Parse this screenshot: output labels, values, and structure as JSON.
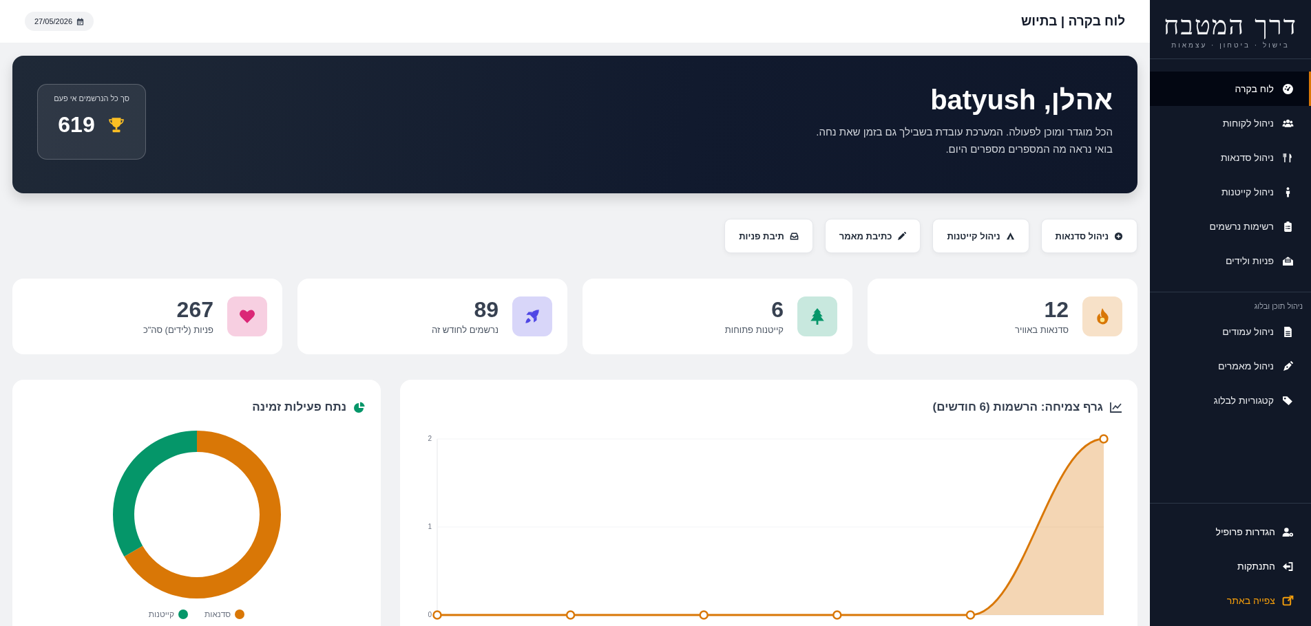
{
  "sidebar": {
    "logo": {
      "title": "דרך המטבח",
      "tagline": "בישול · ביטחון · עצמאות"
    },
    "items": [
      {
        "label": "לוח בקרה",
        "selected": true
      },
      {
        "label": "ניהול לקוחות",
        "selected": false
      },
      {
        "label": "ניהול סדנאות",
        "selected": false
      },
      {
        "label": "ניהול קייטנות",
        "selected": false
      },
      {
        "label": "רשימות נרשמים",
        "selected": false
      },
      {
        "label": "פניות ולידים",
        "selected": false
      }
    ],
    "section_title": "ניהול תוכן ובלוג",
    "blog_items": [
      {
        "label": "ניהול עמודים",
        "selected": false
      },
      {
        "label": "ניהול מאמרים",
        "selected": false
      },
      {
        "label": "קטגוריות לבלוג",
        "selected": false
      }
    ],
    "footer_items": [
      {
        "label": "הגדרות פרופיל",
        "kind": "normal"
      },
      {
        "label": "התנתקות",
        "kind": "normal"
      },
      {
        "label": "צפייה באתר",
        "kind": "external"
      }
    ]
  },
  "header": {
    "title": "לוח בקרה | בתיוש",
    "date": "27/05/2026"
  },
  "banner": {
    "greeting": "אהלן, batyush",
    "lines": [
      "הכל מוגדר ומוכן לפעולה. המערכת עובדת בשבילך גם בזמן שאת נחה.",
      "בואי נראה מה המספרים מספרים היום."
    ],
    "total_label": "סך כל הנרשמים אי פעם",
    "total_value": "619"
  },
  "quick_actions": [
    "ניהול סדנאות",
    "ניהול קייטנות",
    "כתיבת מאמר",
    "תיבת פניות"
  ],
  "stats": [
    {
      "value": "12",
      "label": "סדנאות באוויר",
      "color": "#d97706"
    },
    {
      "value": "6",
      "label": "קייטנות פתוחות",
      "color": "#059669"
    },
    {
      "value": "89",
      "label": "נרשמים לחודש זה",
      "color": "#4f46e5"
    },
    {
      "value": "267",
      "label": "פניות (לידים) סה\"כ",
      "color": "#db2777"
    }
  ],
  "growth_chart": {
    "title": "גרף צמיחה: הרשמות (6 חודשים)",
    "chart_data": {
      "type": "area",
      "ylim": [
        0,
        2
      ],
      "yticks": [
        0,
        1,
        2
      ],
      "series": [
        {
          "color": "#d97706",
          "values": [
            0,
            0,
            0,
            0,
            0,
            2
          ]
        }
      ]
    }
  },
  "activity_chart": {
    "title": "נתח פעילות זמינה",
    "chart_data": {
      "type": "donut",
      "categories": [
        "סדנאות",
        "קייטנות"
      ],
      "values": [
        66.67,
        33.33
      ],
      "colors": [
        "#d97706",
        "#059669"
      ],
      "legend": true
    }
  }
}
